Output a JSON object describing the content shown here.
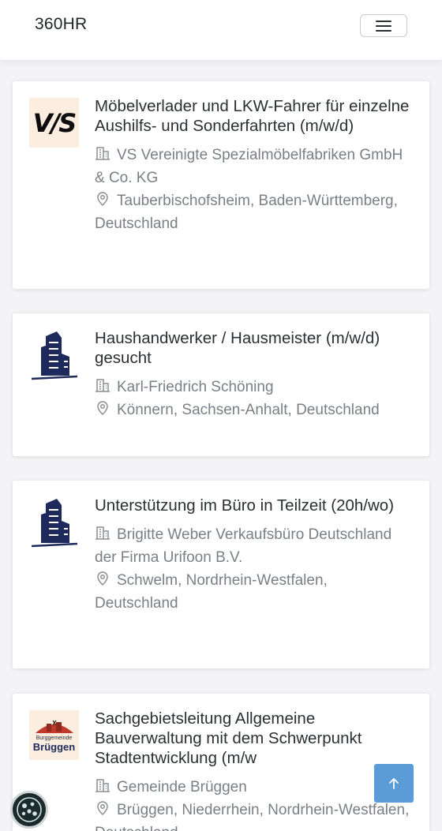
{
  "navbar": {
    "brand": "360HR",
    "menu_icon": "hamburger-menu-icon"
  },
  "jobs": [
    {
      "logo_text": "V/S",
      "title": "Möbelverlader und LKW-Fahrer für einzelne Aushilfs- und Sonderfahrten (m/w/d)",
      "company": "VS Vereinigte Spezialmöbelfabriken GmbH & Co. KG",
      "location": "Tauberbischofsheim, Baden-Württemberg, Deutschland"
    },
    {
      "logo_text": "",
      "title": "Haushandwerker / Hausmeister (m/w/d) gesucht",
      "company": "Karl-Friedrich Schöning",
      "location": "Könnern, Sachsen-Anhalt, Deutschland"
    },
    {
      "logo_text": "",
      "title": "Unterstützung im Büro in Teilzeit (20h/wo)",
      "company": "Brigitte Weber Verkaufsbüro Deutschland der Firma Urifoon B.V.",
      "location": "Schwelm, Nordrhein-Westfalen, Deutschland"
    },
    {
      "logo_text": "Burggemeinde",
      "logo_text_2": "Brüggen",
      "title": "Sachgebietsleitung Allgemeine Bauverwaltung mit dem Schwerpunkt Stadtentwicklung (m/w",
      "company": "Gemeinde Brüggen",
      "location": "Brüggen, Niederrhein, Nordrhein-Westfalen, Deutschland"
    }
  ],
  "icons": {
    "company": "building-icon",
    "location": "map-pin-icon",
    "scroll_top": "arrow-up-icon",
    "cookie": "cookie-settings-icon"
  },
  "colors": {
    "accent": "#5b9bd8",
    "logo_navy": "#1f2a5c",
    "text_muted": "#7a7f86"
  }
}
